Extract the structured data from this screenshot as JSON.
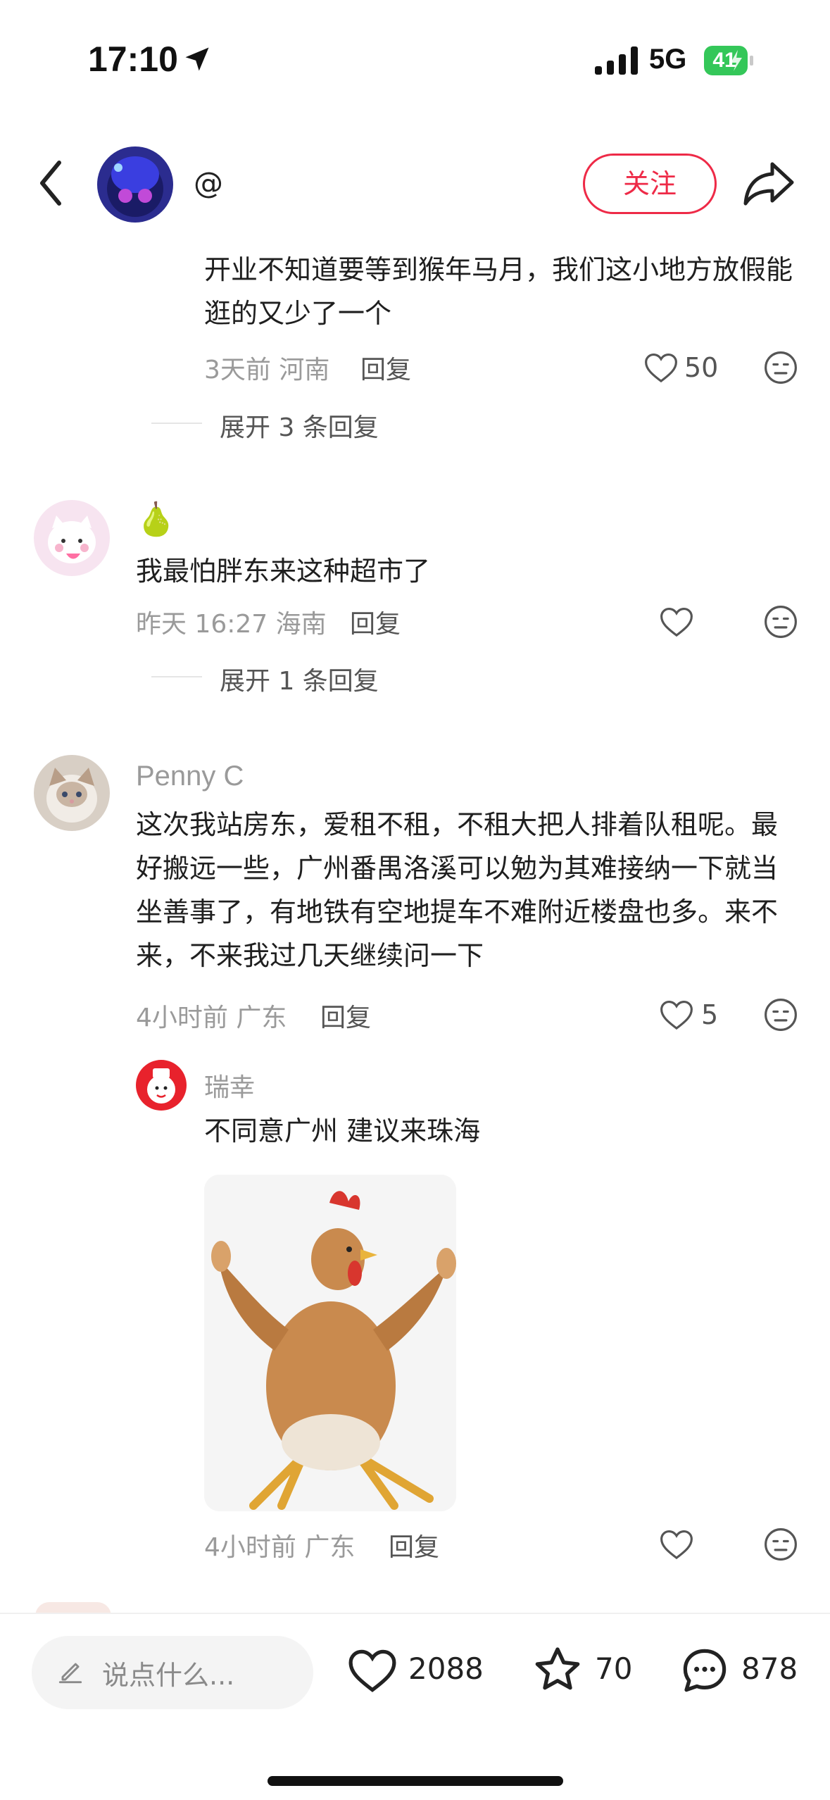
{
  "status_bar": {
    "time": "17:10",
    "network": "5G",
    "battery": "41"
  },
  "header": {
    "handle": "@",
    "follow_label": "关注"
  },
  "comments": [
    {
      "text": "开业不知道要等到猴年马月，我们这小地方放假能逛的又少了一个",
      "meta": "3天前 河南",
      "reply_label": "回复",
      "likes": "50",
      "expand": "展开 3 条回复"
    },
    {
      "name": "🍐",
      "text": "我最怕胖东来这种超市了",
      "meta": "昨天 16:27 海南",
      "reply_label": "回复",
      "likes": "",
      "expand": "展开 1 条回复"
    },
    {
      "name": "Penny C",
      "text": "这次我站房东，爱租不租，不租大把人排着队租呢。最好搬远一些，广州番禺洛溪可以勉为其难接纳一下就当坐善事了，有地铁有空地提车不难附近楼盘也多。来不来，不来我过几天继续问一下",
      "meta": "4小时前 广东",
      "reply_label": "回复",
      "likes": "5",
      "reply": {
        "name": "瑞幸",
        "text": "不同意广州 建议来珠海",
        "meta": "4小时前 广东",
        "reply_label": "回复",
        "likes": ""
      }
    }
  ],
  "bottom_bar": {
    "input_placeholder": "说点什么...",
    "likes": "2088",
    "stars": "70",
    "comments": "878"
  },
  "colors": {
    "accent": "#ee2a47",
    "battery": "#34c759"
  },
  "icons": [
    "location-arrow-icon",
    "signal-icon",
    "battery-icon",
    "back-icon",
    "share-icon",
    "heart-icon",
    "dislike-face-icon",
    "edit-icon",
    "star-icon",
    "comment-icon"
  ]
}
